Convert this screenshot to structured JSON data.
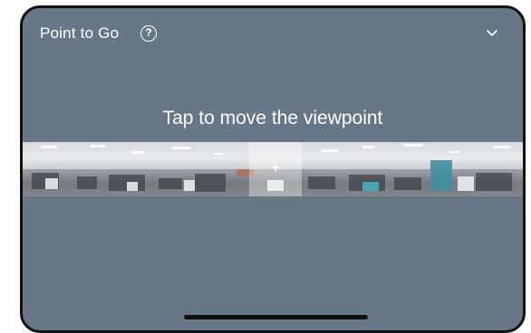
{
  "header": {
    "title": "Point to Go",
    "help_icon": "question-circle-icon",
    "collapse_icon": "chevron-down-icon"
  },
  "main": {
    "hint": "Tap to move the viewpoint"
  },
  "panorama": {
    "viewpoint_marker": "+",
    "marker_icon": "plus-icon"
  },
  "colors": {
    "background": "#687787",
    "text": "#ffffff",
    "frame": "#111111"
  }
}
